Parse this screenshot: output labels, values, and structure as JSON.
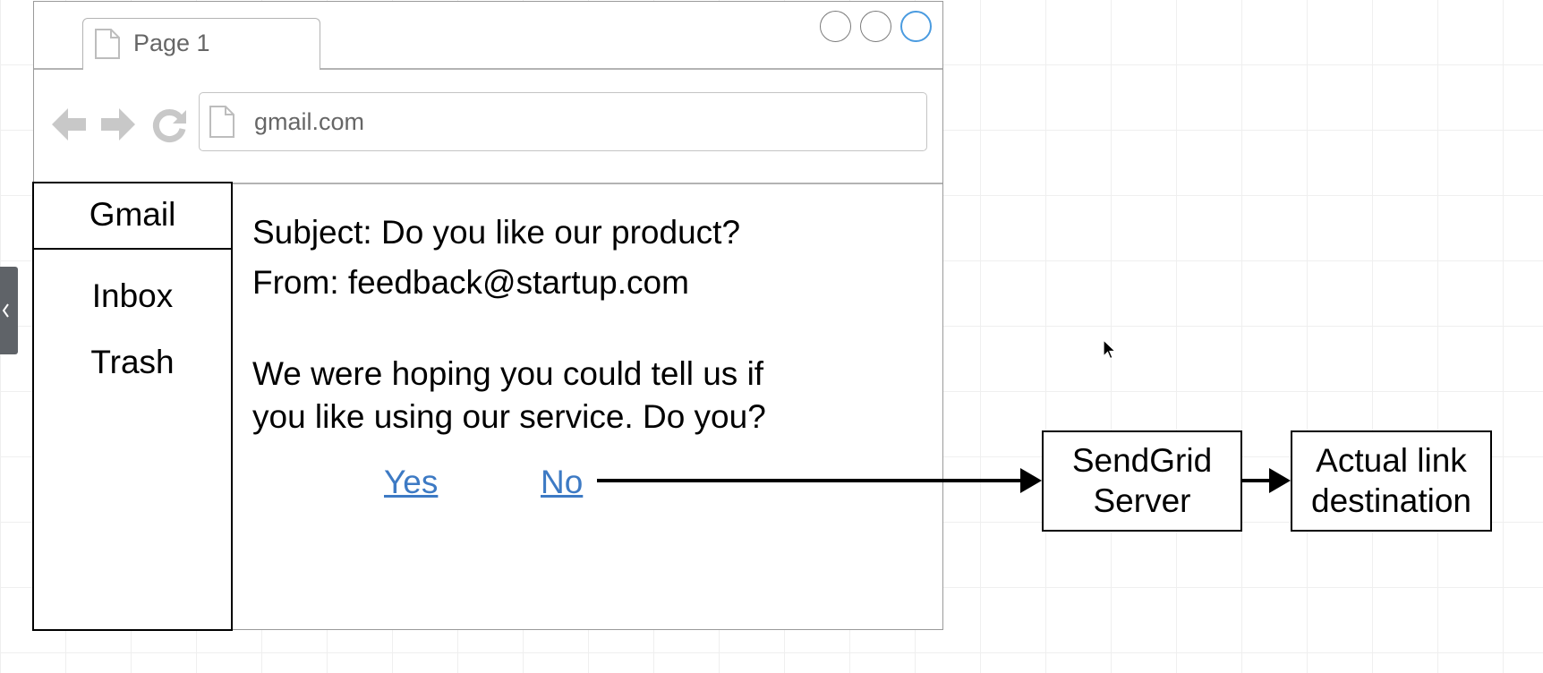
{
  "browser": {
    "tab_label": "Page 1",
    "address": "gmail.com"
  },
  "sidebar": {
    "header": "Gmail",
    "items": [
      {
        "label": "Inbox"
      },
      {
        "label": "Trash"
      }
    ]
  },
  "email": {
    "subject": "Subject: Do you like our product?",
    "from": "From: feedback@startup.com",
    "body_line1": "We were hoping you could tell us if",
    "body_line2": "you like using our service.  Do you?",
    "yes_link": "Yes",
    "no_link": "No"
  },
  "diagram": {
    "sendgrid_line1": "SendGrid",
    "sendgrid_line2": "Server",
    "destination_line1": "Actual link",
    "destination_line2": "destination"
  },
  "colors": {
    "link": "#3d7ac4",
    "active_window_button": "#4a9be0"
  },
  "icons": [
    "page-icon",
    "back-arrow-icon",
    "forward-arrow-icon",
    "reload-icon",
    "mouse-cursor-icon"
  ]
}
